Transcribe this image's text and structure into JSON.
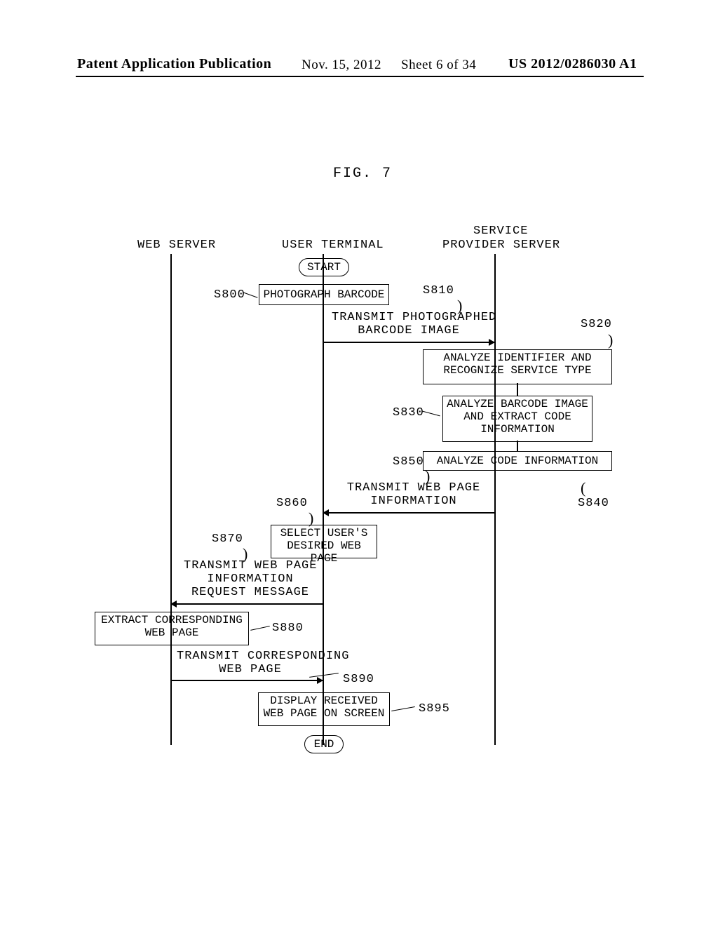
{
  "header": {
    "left": "Patent Application Publication",
    "date": "Nov. 15, 2012",
    "sheet": "Sheet 6 of 34",
    "pubno": "US 2012/0286030 A1"
  },
  "fig_label": "FIG. 7",
  "lanes": {
    "web": "WEB SERVER",
    "user": "USER TERMINAL",
    "sps_line1": "SERVICE",
    "sps_line2": "PROVIDER SERVER"
  },
  "terminals": {
    "start": "START",
    "end": "END"
  },
  "boxes": {
    "s800": "PHOTOGRAPH BARCODE",
    "s820": "ANALYZE IDENTIFIER AND\nRECOGNIZE SERVICE TYPE",
    "s830": "ANALYZE BARCODE\nIMAGE AND EXTRACT\nCODE INFORMATION",
    "s840": "ANALYZE CODE INFORMATION",
    "s860": "SELECT USER'S\nDESIRED WEB PAGE",
    "s880": "EXTRACT CORRESPONDING\nWEB PAGE",
    "s895": "DISPLAY RECEIVED\nWEB PAGE ON SCREEN"
  },
  "msgs": {
    "s810": "TRANSMIT PHOTOGRAPHED\nBARCODE IMAGE",
    "s850": "TRANSMIT WEB PAGE\nINFORMATION",
    "s870": "TRANSMIT WEB PAGE\nINFORMATION\nREQUEST MESSAGE",
    "s890": "TRANSMIT CORRESPONDING\nWEB PAGE"
  },
  "refs": {
    "s800": "S800",
    "s810": "S810",
    "s820": "S820",
    "s830": "S830",
    "s840": "S840",
    "s850": "S850",
    "s860": "S860",
    "s870": "S870",
    "s880": "S880",
    "s890": "S890",
    "s895": "S895"
  }
}
